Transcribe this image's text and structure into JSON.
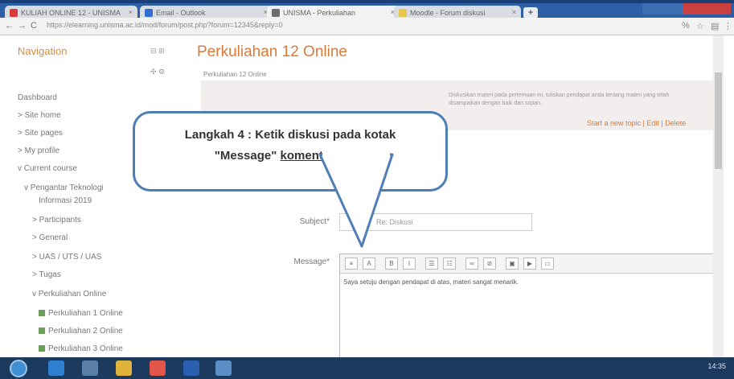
{
  "browser": {
    "tabs": [
      {
        "label": "KULIAH ONLINE 12 - UNISMA",
        "active": false,
        "favicon_color": "#d93b3b"
      },
      {
        "label": "Email - Outlook",
        "active": false,
        "favicon_color": "#2f6fd6"
      },
      {
        "label": "UNISMA - Perkuliahan",
        "active": true,
        "favicon_color": "#6d6d6d"
      },
      {
        "label": "Moodle - Forum diskusi",
        "active": false,
        "favicon_color": "#e6c74a"
      }
    ],
    "new_tab_label": "+",
    "url": "https://elearning.unisma.ac.id/mod/forum/post.php?forum=12345&reply=0"
  },
  "sidebar": {
    "title": "Navigation",
    "items": [
      {
        "label": "Dashboard",
        "indent": 0
      },
      {
        "label": "> Site home",
        "indent": 0
      },
      {
        "label": "> Site pages",
        "indent": 0
      },
      {
        "label": "> My profile",
        "indent": 0
      },
      {
        "label": "v Current course",
        "indent": 0
      },
      {
        "label": "v Pengantar Teknologi",
        "indent": 1
      },
      {
        "label": "Informasi 2019",
        "indent": 2
      },
      {
        "label": "> Participants",
        "indent": 2
      },
      {
        "label": "> General",
        "indent": 2
      },
      {
        "label": "> UAS / UTS / UAS",
        "indent": 2
      },
      {
        "label": "> Tugas",
        "indent": 2
      },
      {
        "label": "v Perkuliahan Online",
        "indent": 2
      },
      {
        "label": "Perkuliahan 1 Online",
        "indent": 3,
        "icon": true
      },
      {
        "label": "Perkuliahan 2 Online",
        "indent": 3,
        "icon": true
      },
      {
        "label": "Perkuliahan 3 Online",
        "indent": 3,
        "icon": true
      }
    ]
  },
  "main": {
    "title": "Perkuliahan 12 Online",
    "breadcrumb": "Perkuliahan 12 Online",
    "notice_text": "Diskusikan materi pada pertemuan ini, tuliskan pendapat anda tentang materi yang telah disampaikan dengan baik dan sopan.",
    "notice_links": "Start a new topic | Edit | Delete",
    "subject_label": "Subject*",
    "subject_value": "Re: Diskusi",
    "message_label": "Message*",
    "editor_text": "Saya setuju dengan pendapat di atas, materi sangat menarik."
  },
  "callout": {
    "line1": "Langkah 4 : Ketik diskusi pada kotak",
    "line2_quote": "\"Message\"",
    "line2_rest": "komentar anda"
  },
  "taskbar": {
    "tray_text": "14:35"
  }
}
